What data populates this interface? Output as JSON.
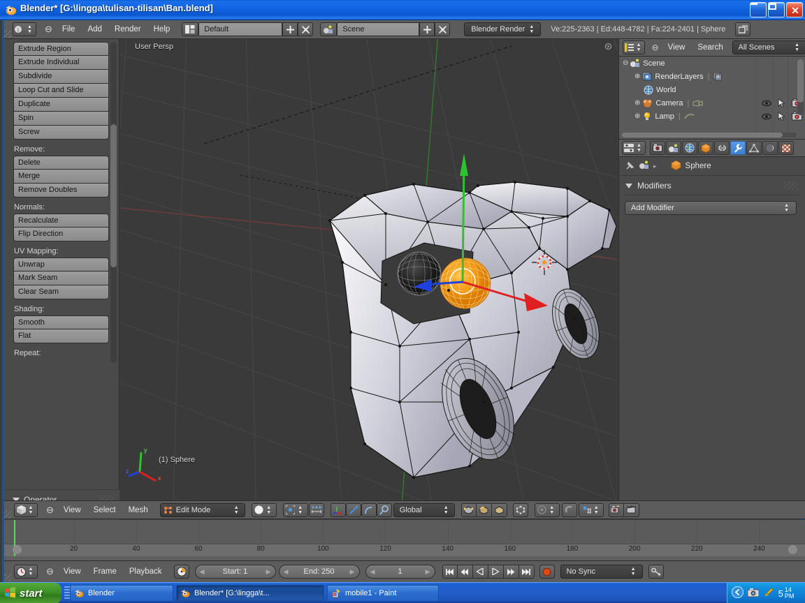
{
  "window": {
    "title": "Blender* [G:\\lingga\\tulisan-tilisan\\Ban.blend]",
    "icon": "blender-logo-icon",
    "minimize": "_",
    "maximize": "□",
    "close": "✕"
  },
  "info_header": {
    "editor_type_icon": "info-editor-icon",
    "collapse_icon": "collapse-menu-icon",
    "menus": [
      "File",
      "Add",
      "Render",
      "Help"
    ],
    "screen_layout_icon": "screen-layout-icon",
    "screen_layout": "Default",
    "screen_add": "+",
    "screen_delete": "✕",
    "scene_icon": "scene-data-icon",
    "scene": "Scene",
    "scene_add": "+",
    "scene_delete": "✕",
    "render_engine": "Blender Render",
    "stats": "Ve:225-2363 | Ed:448-4782 | Fa:224-2401 | Sphere",
    "resize_icon": "window-restore-icon"
  },
  "toolshelf": {
    "groups": [
      {
        "label": "",
        "buttons": [
          "Extrude Region",
          "Extrude Individual",
          "Subdivide",
          "Loop Cut and Slide",
          "Duplicate",
          "Spin",
          "Screw"
        ]
      },
      {
        "label": "Remove:",
        "buttons": [
          "Delete",
          "Merge",
          "Remove Doubles"
        ]
      },
      {
        "label": "Normals:",
        "buttons": [
          "Recalculate",
          "Flip Direction"
        ]
      },
      {
        "label": "UV Mapping:",
        "buttons": [
          "Unwrap",
          "Mark Seam",
          "Clear Seam"
        ]
      },
      {
        "label": "Shading:",
        "buttons": [
          "Smooth",
          "Flat"
        ]
      },
      {
        "label": "Repeat:",
        "buttons": []
      }
    ],
    "operator_panel_title": "Operator"
  },
  "viewport": {
    "perspective_label": "User Persp",
    "object_label": "(1) Sphere",
    "axis_gizmo": {
      "x": "x",
      "y": "y",
      "z": "z"
    }
  },
  "view3d_header": {
    "editor_type_icon": "view3d-editor-icon",
    "collapse_icon": "collapse-menu-icon",
    "menus": [
      "View",
      "Select",
      "Mesh"
    ],
    "mode_icon": "edit-mode-icon",
    "mode": "Edit Mode",
    "shading_icon": "solid-shading-icon",
    "pivot_icon": "pivot-median-point-icon",
    "snap_to_icon": "proportional-edit-icon",
    "manipulator_icons": [
      "translate-manipulator-icon",
      "rotate-manipulator-icon",
      "scale-manipulator-icon"
    ],
    "transform_orientation": "Global",
    "mesh_select_modes": [
      "vertex-select-icon",
      "edge-select-icon",
      "face-select-icon"
    ],
    "occlude_icon": "limit-selection-visible-icon",
    "proportional_edit_icon": "proportional-editing-off-icon",
    "snap_magnet_icon": "snap-magnet-icon",
    "snap_element_icon": "snap-increment-icon",
    "render_icons": [
      "render-opengl-image-icon",
      "render-opengl-animation-icon"
    ]
  },
  "outliner": {
    "editor_type_icon": "outliner-editor-icon",
    "collapse_icon": "collapse-menu-icon",
    "menus": [
      "View",
      "Search"
    ],
    "display_mode": "All Scenes",
    "rows": [
      {
        "label": "Scene",
        "icon": "scene-icon",
        "indent": 0,
        "expander": "minus",
        "cols": []
      },
      {
        "label": "RenderLayers",
        "icon": "renderlayers-icon",
        "indent": 1,
        "expander": "plus",
        "extra_icon": "renderlayers-data-icon",
        "cols": []
      },
      {
        "label": "World",
        "icon": "world-icon",
        "indent": 1,
        "expander": "none",
        "cols": []
      },
      {
        "label": "Camera",
        "icon": "camera-object-icon",
        "indent": 1,
        "expander": "plus",
        "extra_icon": "camera-data-icon",
        "cols": [
          "eye-icon",
          "cursor-icon",
          "camera-render-icon"
        ]
      },
      {
        "label": "Lamp",
        "icon": "lamp-object-icon",
        "indent": 1,
        "expander": "plus",
        "extra_icon": "lamp-data-icon",
        "cols": [
          "eye-icon",
          "cursor-icon",
          "camera-render-icon"
        ]
      }
    ]
  },
  "properties": {
    "editor_type_icon": "properties-editor-icon",
    "tabs": [
      {
        "name": "render-tab",
        "icon": "camera-back-icon",
        "active": false
      },
      {
        "name": "scene-tab",
        "icon": "scene-icon",
        "active": false
      },
      {
        "name": "world-tab",
        "icon": "world-icon",
        "active": false
      },
      {
        "name": "object-tab",
        "icon": "object-cube-icon",
        "active": false
      },
      {
        "name": "constraints-tab",
        "icon": "chain-link-icon",
        "active": false
      },
      {
        "name": "modifiers-tab",
        "icon": "wrench-icon",
        "active": true
      },
      {
        "name": "data-tab",
        "icon": "mesh-data-icon",
        "active": false
      },
      {
        "name": "material-tab",
        "icon": "material-sphere-icon",
        "active": false
      },
      {
        "name": "texture-tab",
        "icon": "checker-texture-icon",
        "active": false
      }
    ],
    "pin_icon": "pin-icon",
    "breadcrumb_object_icon": "object-data-icon",
    "breadcrumb_arrow": "▸",
    "breadcrumb_mesh_icon": "mesh-cube-icon",
    "breadcrumb_name": "Sphere",
    "panel_title": "Modifiers",
    "add_modifier": "Add Modifier"
  },
  "timeline": {
    "editor_type_icon": "timeline-editor-icon",
    "collapse_icon": "collapse-menu-icon",
    "menus": [
      "View",
      "Frame",
      "Playback"
    ],
    "auto_key_icon": "auto-keyframe-icon",
    "start_label": "Start: 1",
    "end_label": "End: 250",
    "current_frame": "1",
    "transport_icons": [
      "jump-to-start-icon",
      "skip-back-icon",
      "play-reverse-icon",
      "play-icon",
      "skip-forward-icon",
      "jump-to-end-icon"
    ],
    "record_icon": "record-icon",
    "sync_mode": "No Sync",
    "keying_set_icon": "keying-set-icon",
    "ruler_ticks": [
      20,
      40,
      60,
      80,
      100,
      120,
      140,
      160,
      180,
      200,
      220,
      240
    ],
    "playhead_frame": 1
  },
  "taskbar": {
    "start_label": "start",
    "start_icon": "windows-flag-icon",
    "tasks": [
      {
        "label": "Blender",
        "icon": "blender-logo-icon",
        "active": false
      },
      {
        "label": "Blender* [G:\\lingga\\t...",
        "icon": "blender-logo-icon",
        "active": true
      },
      {
        "label": "mobile1 - Paint",
        "icon": "paint-icon",
        "active": false
      }
    ],
    "tray_icons": [
      "show-hidden-icons-icon",
      "camera-tray-icon",
      "paint-tray-icon"
    ],
    "clock_hour": "5",
    "clock_minute": "14",
    "clock_period": "PM"
  },
  "colors": {
    "accent_blue": "#0a58cf",
    "selected_orange": "#f09a22",
    "axis_x": "#e02020",
    "axis_y": "#2fc22f",
    "axis_z": "#2040e0",
    "active_tab": "#4b8ddc"
  }
}
